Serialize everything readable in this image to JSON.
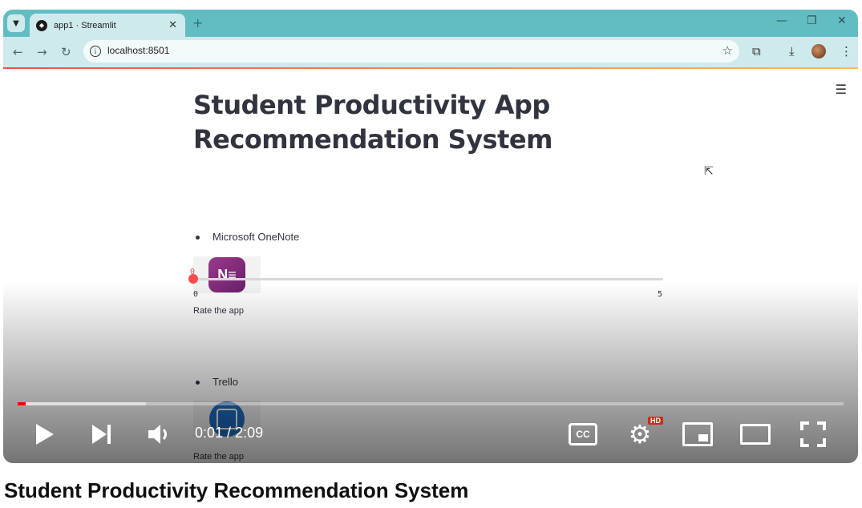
{
  "browser": {
    "tab_title": "app1 · Streamlit",
    "url": "localhost:8501"
  },
  "page": {
    "title": "Student Productivity App Recommendation System",
    "apps": [
      {
        "name": "Microsoft OneNote",
        "rate_label": "Rate the app",
        "rating": 0,
        "min": "0",
        "max": "5",
        "value_label": "0"
      },
      {
        "name": "Trello",
        "rate_label": "Rate the app"
      }
    ]
  },
  "player": {
    "current_time": "0:01",
    "separator": " / ",
    "duration": "2:09",
    "played_fraction": 0.01,
    "hd_badge": "HD",
    "cc_label": "CC"
  },
  "video_title": "Student Productivity Recommendation System"
}
